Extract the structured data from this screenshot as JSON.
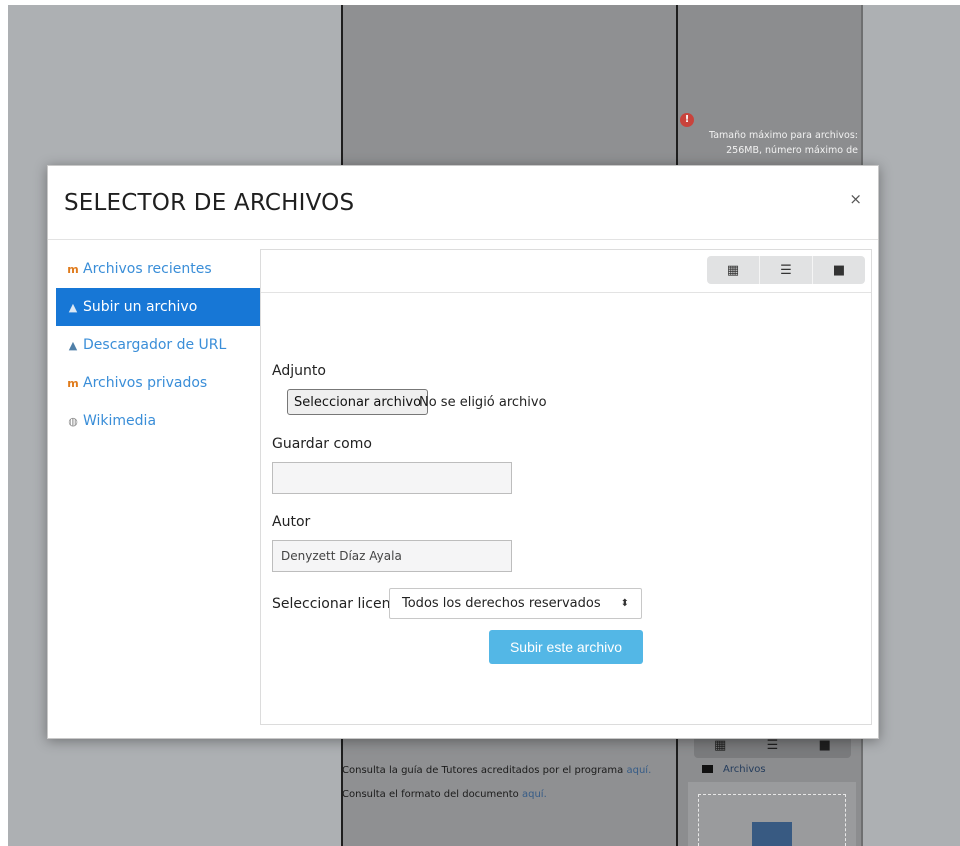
{
  "background": {
    "max_size_note_line1": "Tamaño máximo para archivos:",
    "max_size_note_line2": "256MB, número máximo de",
    "files_label": "Archivos",
    "line1_text": "Consulta la guía de Tutores acreditados por el programa ",
    "line1_link": "aquí.",
    "line2_text": "Consulta el formato del documento ",
    "line2_link": "aquí."
  },
  "modal": {
    "title": "SELECTOR DE ARCHIVOS",
    "close_label": "×"
  },
  "sidebar": {
    "items": [
      {
        "label": "Archivos recientes",
        "icon": "moodle-icon"
      },
      {
        "label": "Subir un archivo",
        "icon": "upload-icon"
      },
      {
        "label": "Descargador de URL",
        "icon": "url-download-icon"
      },
      {
        "label": "Archivos privados",
        "icon": "moodle-icon"
      },
      {
        "label": "Wikimedia",
        "icon": "wikimedia-icon"
      }
    ],
    "active_index": 1
  },
  "toolbar": {
    "views": [
      "grid-view-icon",
      "list-view-icon",
      "folder-view-icon"
    ]
  },
  "form": {
    "attachment_label": "Adjunto",
    "choose_file_label": "Seleccionar archivo",
    "no_file_text": "No se eligió archivo",
    "save_as_label": "Guardar como",
    "save_as_value": "",
    "author_label": "Autor",
    "author_value": "Denyzett Díaz Ayala",
    "license_label": "Seleccionar licencia",
    "license_value": "Todos los derechos reservados",
    "submit_label": "Subir este archivo"
  },
  "colors": {
    "active_item": "#1777d6",
    "link": "#3a8ed8",
    "submit": "#53b7e6"
  }
}
